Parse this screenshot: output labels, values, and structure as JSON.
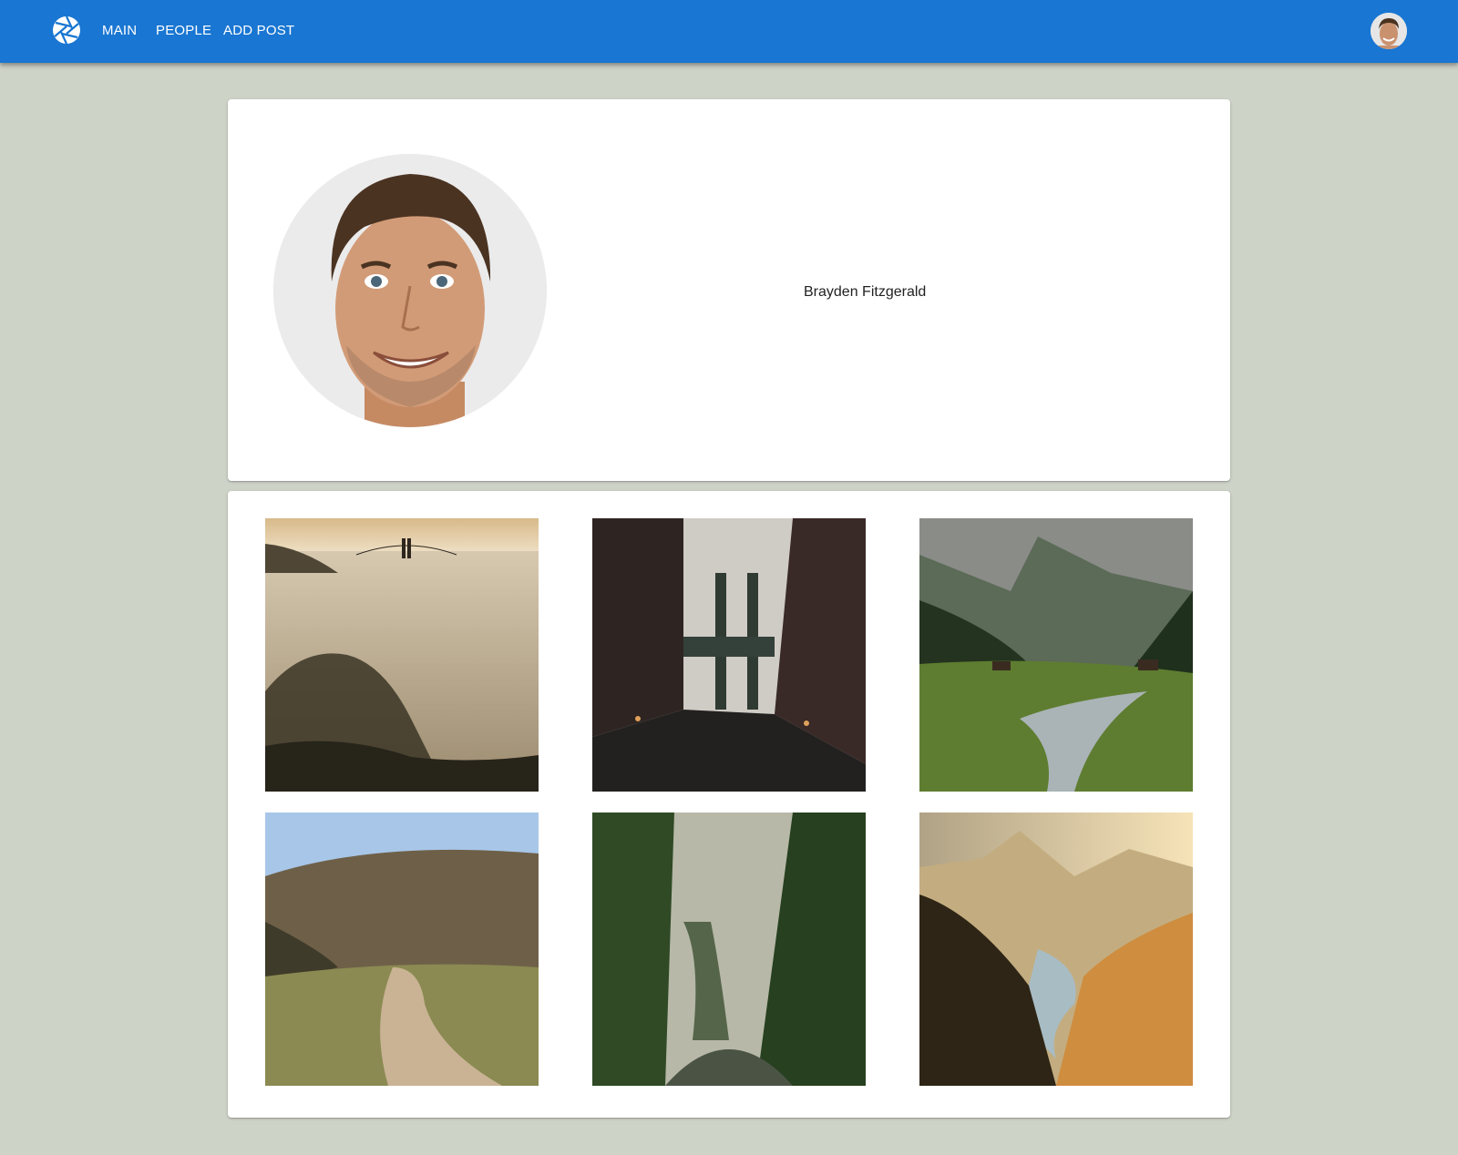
{
  "appbar": {
    "logo_icon": "camera-aperture-icon",
    "nav": [
      {
        "label": "MAIN"
      },
      {
        "label": "PEOPLE"
      },
      {
        "label": "ADD POST"
      }
    ],
    "avatar_icon": "user-avatar-icon",
    "color": "#1976d2"
  },
  "profile": {
    "name": "Brayden Fitzgerald",
    "avatar_icon": "profile-photo"
  },
  "gallery": {
    "posts": [
      {
        "icon": "photo-foggy-bridge"
      },
      {
        "icon": "photo-city-bridge-street"
      },
      {
        "icon": "photo-mountain-valley-river"
      },
      {
        "icon": "photo-dirt-road-hill"
      },
      {
        "icon": "photo-misty-forest-road"
      },
      {
        "icon": "photo-sunset-mountain-lake"
      }
    ]
  }
}
